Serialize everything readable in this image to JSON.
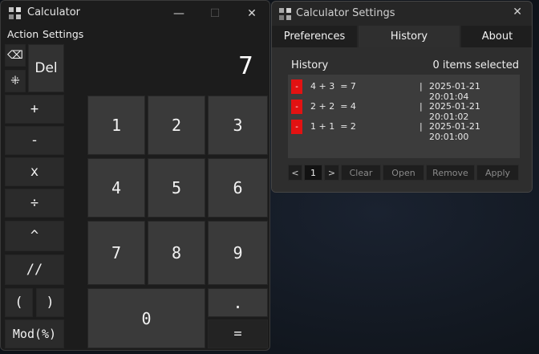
{
  "calculator": {
    "title": "Calculator",
    "menu": [
      "Action",
      "Settings"
    ],
    "display": "7",
    "keys": {
      "backspace": "⌫",
      "clear_entry": "⁜",
      "del": "Del",
      "plus": "+",
      "minus": "-",
      "multiply": "x",
      "divide": "÷",
      "power": "^",
      "floordiv": "//",
      "lparen": "(",
      "rparen": ")",
      "mod": "Mod(%)",
      "d1": "1",
      "d2": "2",
      "d3": "3",
      "d4": "4",
      "d5": "5",
      "d6": "6",
      "d7": "7",
      "d8": "8",
      "d9": "9",
      "d0": "0",
      "dot": ".",
      "equals": "="
    }
  },
  "settings": {
    "title": "Calculator Settings",
    "tabs": [
      "Preferences",
      "History",
      "About"
    ],
    "active_tab": "History",
    "history_label": "History",
    "selected_count": "0 items selected",
    "history": [
      {
        "expr": "4 + 3  = 7",
        "time": "2025-01-21 20:01:04"
      },
      {
        "expr": "2 + 2  = 4",
        "time": "2025-01-21 20:01:02"
      },
      {
        "expr": "1 + 1  = 2",
        "time": "2025-01-21 20:01:00"
      }
    ],
    "pager": {
      "prev": "<",
      "page": "1",
      "next": ">",
      "clear": "Clear",
      "open": "Open",
      "remove": "Remove",
      "apply": "Apply"
    },
    "delete_glyph": "-",
    "separator": "|"
  }
}
